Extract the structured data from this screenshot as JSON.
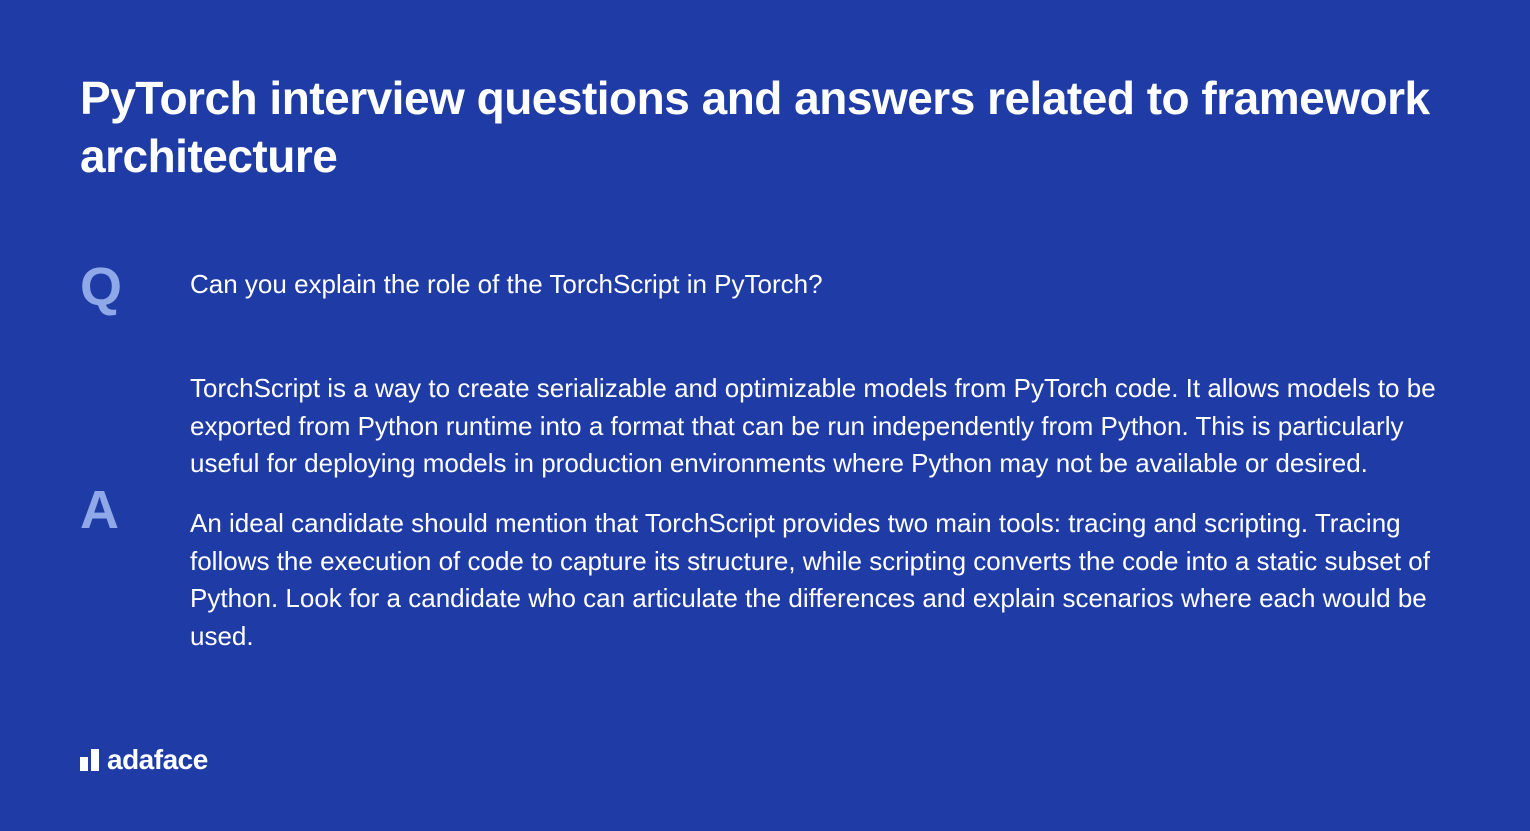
{
  "title": "PyTorch interview questions and answers related to framework architecture",
  "question": {
    "letter": "Q",
    "text": "Can you explain the role of the TorchScript in PyTorch?"
  },
  "answer": {
    "letter": "A",
    "paragraphs": [
      "TorchScript is a way to create serializable and optimizable models from PyTorch code. It allows models to be exported from Python runtime into a format that can be run independently from Python. This is particularly useful for deploying models in production environments where Python may not be available or desired.",
      "An ideal candidate should mention that TorchScript provides two main tools: tracing and scripting. Tracing follows the execution of code to capture its structure, while scripting converts the code into a static subset of Python. Look for a candidate who can articulate the differences and explain scenarios where each would be used."
    ]
  },
  "brand": "adaface"
}
